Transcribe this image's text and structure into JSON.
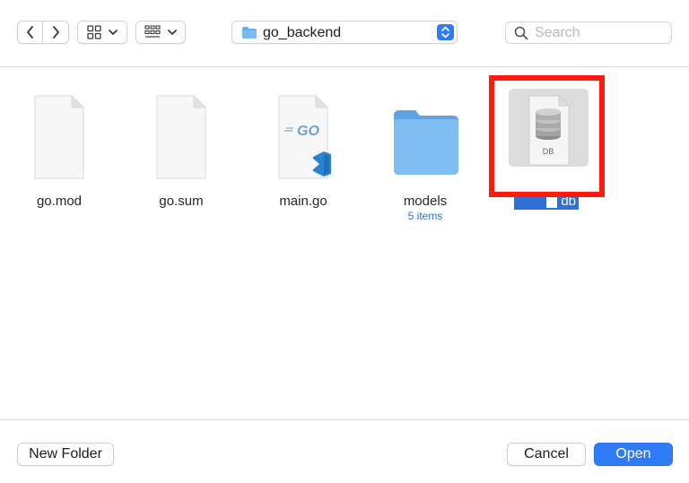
{
  "toolbar": {
    "path_label": "go_backend",
    "search_placeholder": "Search"
  },
  "files": [
    {
      "name": "go.mod",
      "icon": "document-icon"
    },
    {
      "name": "go.sum",
      "icon": "document-icon"
    },
    {
      "name": "main.go",
      "icon": "go-file-icon",
      "badge_text": "GO"
    },
    {
      "name": "models",
      "icon": "folder-icon",
      "subtitle": "5 items"
    },
    {
      "name": "db",
      "icon": "database-file-icon",
      "badge_text": "DB",
      "selected": true,
      "renaming": true
    }
  ],
  "buttons": {
    "new_folder": "New Folder",
    "cancel": "Cancel",
    "open": "Open"
  },
  "colors": {
    "accent": "#2f7cf6",
    "selection": "#2f6fd6",
    "highlight_box": "#ff1a0d",
    "folder": "#6aaee8"
  }
}
